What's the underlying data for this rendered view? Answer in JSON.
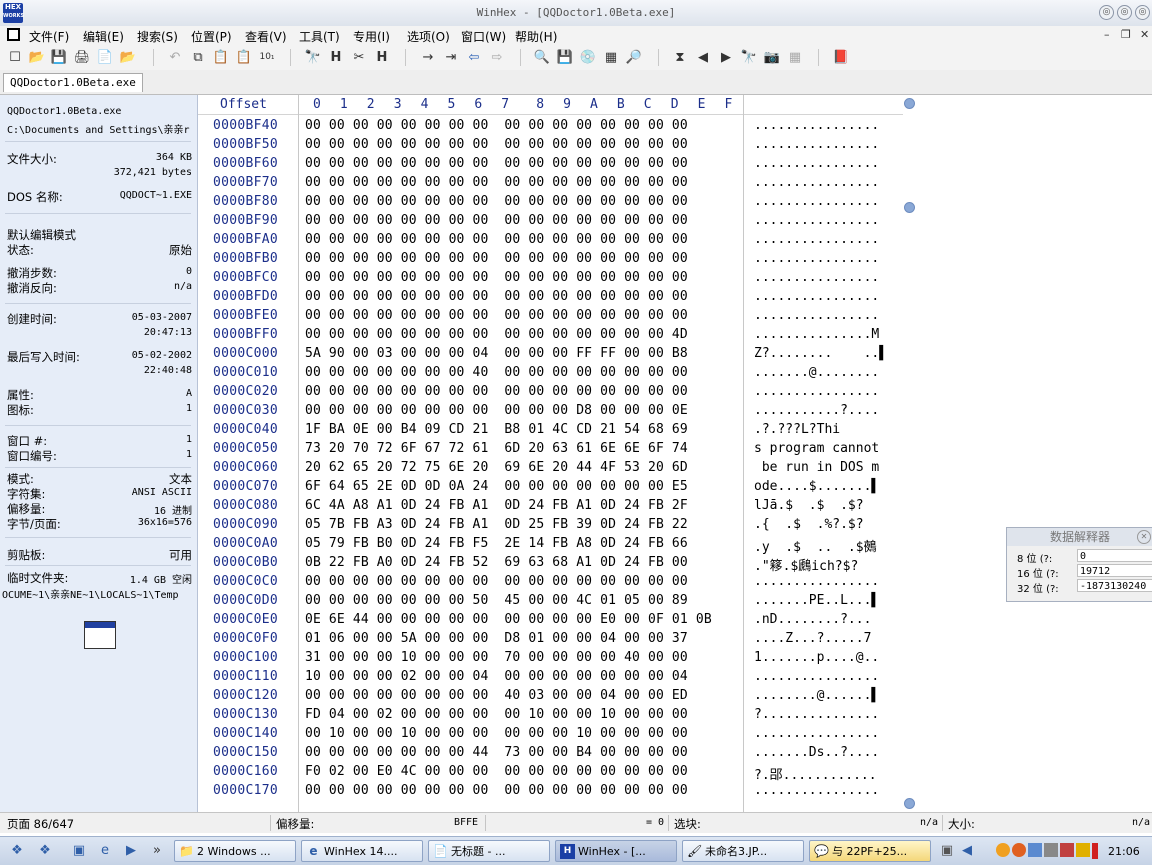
{
  "window": {
    "title": "WinHex - [QQDoctor1.0Beta.exe]",
    "app_icon_line1": "HEX",
    "app_icon_line2": "WORKS",
    "controls": [
      "◎",
      "◎",
      "◎",
      "◎"
    ]
  },
  "menu": {
    "items": [
      "文件(F)",
      "编辑(E)",
      "搜索(S)",
      "位置(P)",
      "查看(V)",
      "工具(T)",
      "专用(I)",
      "选项(O)",
      "窗口(W)",
      "帮助(H)"
    ],
    "mdi": [
      "–",
      "❐",
      "✕"
    ]
  },
  "toolbar": {
    "icons": [
      "☐",
      "📂",
      "💾",
      "🖨",
      "📄",
      "📂",
      "↶",
      "⧉",
      "📋",
      "📋",
      "10₁",
      "🔭",
      "H",
      "✂",
      "H",
      "→",
      "⇥",
      "⇦",
      "⇨",
      "🔍",
      "💾",
      "💿",
      "▦",
      "🔎",
      "⧗",
      "◀",
      "▶",
      "🔭",
      "📷",
      "▦",
      "📕"
    ]
  },
  "tab": {
    "label": "QQDoctor1.0Beta.exe"
  },
  "info": {
    "filename": "QQDoctor1.0Beta.exe",
    "path": "C:\\Documents and Settings\\亲亲r",
    "file_size_label": "文件大小:",
    "file_size_kb": "364 KB",
    "file_size_bytes": "372,421 bytes",
    "dos_name_label": "DOS 名称:",
    "dos_name": "QQDOCT~1.EXE",
    "edit_mode": "默认编辑模式",
    "state_label": "状态:",
    "state": "原始",
    "undo_label": "撤消步数:",
    "undo": "0",
    "redo_label": "撤消反向:",
    "redo": "n/a",
    "created_label": "创建时间:",
    "created_date": "05-03-2007",
    "created_time": "20:47:13",
    "modified_label": "最后写入时间:",
    "modified_date": "05-02-2002",
    "modified_time": "22:40:48",
    "attr_label": "属性:",
    "attr": "A",
    "icons_label": "图标:",
    "icons": "1",
    "window_num_label": "窗口 #:",
    "window_num": "1",
    "window_no_label": "窗口编号:",
    "window_no": "1",
    "mode_label": "模式:",
    "mode": "文本",
    "charset_label": "字符集:",
    "charset": "ANSI ASCII",
    "offset_label": "偏移量:",
    "offset": "16 进制",
    "bpp_label": "字节/页面:",
    "bpp": "36x16=576",
    "clipboard_label": "剪贴板:",
    "clipboard": "可用",
    "temp_label": "临时文件夹:",
    "temp": "1.4 GB 空闲",
    "temp_path": "OCUME~1\\亲亲NE~1\\LOCALS~1\\Temp"
  },
  "hex": {
    "offset_header": "Offset",
    "columns": [
      "0",
      "1",
      "2",
      "3",
      "4",
      "5",
      "6",
      "7",
      "8",
      "9",
      "A",
      "B",
      "C",
      "D",
      "E",
      "F"
    ],
    "rows": [
      {
        "off": "0000BF40",
        "hex": "00 00 00 00 00 00 00 00  00 00 00 00 00 00 00 00",
        "txt": "................"
      },
      {
        "off": "0000BF50",
        "hex": "00 00 00 00 00 00 00 00  00 00 00 00 00 00 00 00",
        "txt": "................"
      },
      {
        "off": "0000BF60",
        "hex": "00 00 00 00 00 00 00 00  00 00 00 00 00 00 00 00",
        "txt": "................"
      },
      {
        "off": "0000BF70",
        "hex": "00 00 00 00 00 00 00 00  00 00 00 00 00 00 00 00",
        "txt": "................"
      },
      {
        "off": "0000BF80",
        "hex": "00 00 00 00 00 00 00 00  00 00 00 00 00 00 00 00",
        "txt": "................"
      },
      {
        "off": "0000BF90",
        "hex": "00 00 00 00 00 00 00 00  00 00 00 00 00 00 00 00",
        "txt": "................"
      },
      {
        "off": "0000BFA0",
        "hex": "00 00 00 00 00 00 00 00  00 00 00 00 00 00 00 00",
        "txt": "................"
      },
      {
        "off": "0000BFB0",
        "hex": "00 00 00 00 00 00 00 00  00 00 00 00 00 00 00 00",
        "txt": "................"
      },
      {
        "off": "0000BFC0",
        "hex": "00 00 00 00 00 00 00 00  00 00 00 00 00 00 00 00",
        "txt": "................"
      },
      {
        "off": "0000BFD0",
        "hex": "00 00 00 00 00 00 00 00  00 00 00 00 00 00 00 00",
        "txt": "................"
      },
      {
        "off": "0000BFE0",
        "hex": "00 00 00 00 00 00 00 00  00 00 00 00 00 00 00 00",
        "txt": "................"
      },
      {
        "off": "0000BFF0",
        "hex": "00 00 00 00 00 00 00 00  00 00 00 00 00 00 00 4D",
        "txt": "...............M"
      },
      {
        "off": "0000C000",
        "hex": "5A 90 00 03 00 00 00 04  00 00 00 FF FF 00 00 B8",
        "txt": "Z?........    ..▌"
      },
      {
        "off": "0000C010",
        "hex": "00 00 00 00 00 00 00 40  00 00 00 00 00 00 00 00",
        "txt": ".......@........"
      },
      {
        "off": "0000C020",
        "hex": "00 00 00 00 00 00 00 00  00 00 00 00 00 00 00 00",
        "txt": "................"
      },
      {
        "off": "0000C030",
        "hex": "00 00 00 00 00 00 00 00  00 00 00 D8 00 00 00 0E",
        "txt": "...........?...."
      },
      {
        "off": "0000C040",
        "hex": "1F BA 0E 00 B4 09 CD 21  B8 01 4C CD 21 54 68 69",
        "txt": ".?.???L?Thi"
      },
      {
        "off": "0000C050",
        "hex": "73 20 70 72 6F 67 72 61  6D 20 63 61 6E 6E 6F 74",
        "txt": "s program cannot"
      },
      {
        "off": "0000C060",
        "hex": "20 62 65 20 72 75 6E 20  69 6E 20 44 4F 53 20 6D",
        "txt": " be run in DOS m"
      },
      {
        "off": "0000C070",
        "hex": "6F 64 65 2E 0D 0D 0A 24  00 00 00 00 00 00 00 E5",
        "txt": "ode....$.......▌"
      },
      {
        "off": "0000C080",
        "hex": "6C 4A A8 A1 0D 24 FB A1  0D 24 FB A1 0D 24 FB 2F",
        "txt": "lJā.$  .$  .$?"
      },
      {
        "off": "0000C090",
        "hex": "05 7B FB A3 0D 24 FB A1  0D 25 FB 39 0D 24 FB 22",
        "txt": ".{  .$  .%?.$?"
      },
      {
        "off": "0000C0A0",
        "hex": "05 79 FB B0 0D 24 FB F5  2E 14 FB A8 0D 24 FB 66",
        "txt": ".y  .$  ..  .$鵺"
      },
      {
        "off": "0000C0B0",
        "hex": "0B 22 FB A0 0D 24 FB 52  69 63 68 A1 0D 24 FB 00",
        "txt": ".\"簃.$鷉ich?$?"
      },
      {
        "off": "0000C0C0",
        "hex": "00 00 00 00 00 00 00 00  00 00 00 00 00 00 00 00",
        "txt": "................"
      },
      {
        "off": "0000C0D0",
        "hex": "00 00 00 00 00 00 00 50  45 00 00 4C 01 05 00 89",
        "txt": ".......PE..L...▌"
      },
      {
        "off": "0000C0E0",
        "hex": "0E 6E 44 00 00 00 00 00  00 00 00 00 E0 00 0F 01 0B",
        "txt": ".nD........?..."
      },
      {
        "off": "0000C0F0",
        "hex": "01 06 00 00 5A 00 00 00  D8 01 00 00 04 00 00 37",
        "txt": "....Z...?.....7"
      },
      {
        "off": "0000C100",
        "hex": "31 00 00 00 10 00 00 00  70 00 00 00 00 40 00 00",
        "txt": "1.......p....@.."
      },
      {
        "off": "0000C110",
        "hex": "10 00 00 00 02 00 00 04  00 00 00 00 00 00 00 04",
        "txt": "................"
      },
      {
        "off": "0000C120",
        "hex": "00 00 00 00 00 00 00 00  40 03 00 00 04 00 00 ED",
        "txt": "........@......▌"
      },
      {
        "off": "0000C130",
        "hex": "FD 04 00 02 00 00 00 00  00 10 00 00 10 00 00 00",
        "txt": "?..............."
      },
      {
        "off": "0000C140",
        "hex": "00 10 00 00 10 00 00 00  00 00 00 10 00 00 00 00",
        "txt": "................"
      },
      {
        "off": "0000C150",
        "hex": "00 00 00 00 00 00 00 44  73 00 00 B4 00 00 00 00",
        "txt": ".......Ds..?...."
      },
      {
        "off": "0000C160",
        "hex": "F0 02 00 E0 4C 00 00 00  00 00 00 00 00 00 00 00",
        "txt": "?.郘............"
      },
      {
        "off": "0000C170",
        "hex": "00 00 00 00 00 00 00 00  00 00 00 00 00 00 00 00",
        "txt": "................"
      }
    ]
  },
  "interpreter": {
    "title": "数据解释器",
    "close": "✕",
    "rows": [
      {
        "label": "8 位 (?:",
        "value": "0"
      },
      {
        "label": "16 位 (?:",
        "value": "19712"
      },
      {
        "label": "32 位 (?:",
        "value": "-1873130240"
      }
    ]
  },
  "status": {
    "page": "页面 86/647",
    "offset_label": "偏移量:",
    "offset_value": "BFFE",
    "eq": "= 0",
    "block_label": "选块:",
    "block_value": "n/a",
    "size_label": "大小:",
    "size_value": "n/a"
  },
  "taskbar": {
    "buttons": [
      {
        "label": "2 Windows ...",
        "icon": "📁"
      },
      {
        "label": "WinHex 14....",
        "icon": "e"
      },
      {
        "label": "无标题 - ...",
        "icon": "📄"
      },
      {
        "label": "WinHex - [...",
        "icon": "H"
      },
      {
        "label": "未命名3.JP...",
        "icon": "🖌"
      },
      {
        "label": "与 22PF+25...",
        "icon": "💬"
      }
    ],
    "clock": "21:06"
  }
}
